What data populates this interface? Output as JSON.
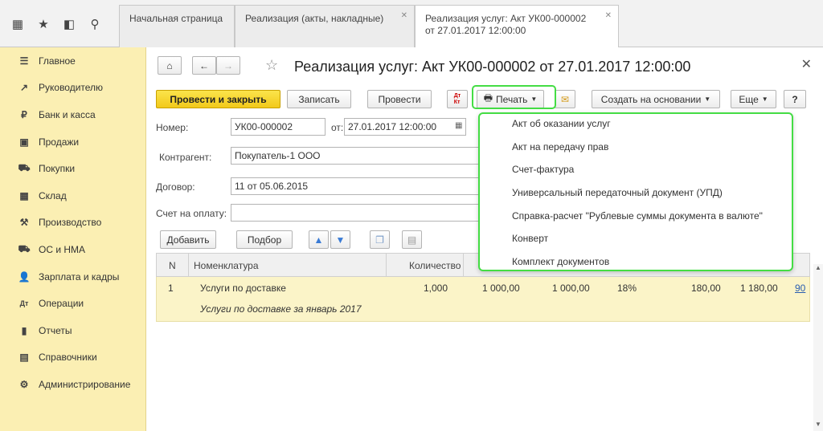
{
  "toolbar_icons": [
    "apps-grid-icon",
    "star-icon",
    "history-icon",
    "search-icon"
  ],
  "tabs": [
    {
      "label": "Начальная страница"
    },
    {
      "label": "Реализация (акты, накладные)"
    },
    {
      "label_line1": "Реализация услуг: Акт УК00-000002",
      "label_line2": "от 27.01.2017 12:00:00"
    }
  ],
  "sidebar": {
    "items": [
      {
        "label": "Главное",
        "icon": "☰"
      },
      {
        "label": "Руководителю",
        "icon": "↗"
      },
      {
        "label": "Банк и касса",
        "icon": "₽"
      },
      {
        "label": "Продажи",
        "icon": "▣"
      },
      {
        "label": "Покупки",
        "icon": "⛟"
      },
      {
        "label": "Склад",
        "icon": "▦"
      },
      {
        "label": "Производство",
        "icon": "⚒"
      },
      {
        "label": "ОС и НМА",
        "icon": "⛟"
      },
      {
        "label": "Зарплата и кадры",
        "icon": "👤"
      },
      {
        "label": "Операции",
        "icon": "Дт"
      },
      {
        "label": "Отчеты",
        "icon": "▮"
      },
      {
        "label": "Справочники",
        "icon": "▤"
      },
      {
        "label": "Администрирование",
        "icon": "⚙"
      }
    ]
  },
  "document": {
    "title": "Реализация услуг: Акт УК00-000002 от 27.01.2017 12:00:00",
    "buttons": {
      "post_close": "Провести и закрыть",
      "save": "Записать",
      "post": "Провести",
      "print": "Печать",
      "create_based": "Создать на основании",
      "more": "Еще",
      "help": "?"
    },
    "fields": {
      "number_label": "Номер:",
      "number_value": "УК00-000002",
      "date_label": "от:",
      "date_value": "27.01.2017 12:00:00",
      "counterparty_label": "Контрагент:",
      "counterparty_value": "Покупатель-1 ООО",
      "contract_label": "Договор:",
      "contract_value": "11 от 05.06.2015",
      "invoice_label": "Счет на оплату:",
      "invoice_value": ""
    },
    "table_buttons": {
      "add": "Добавить",
      "select": "Подбор"
    },
    "table": {
      "columns": [
        "N",
        "Номенклатура",
        "Количество"
      ],
      "rows": [
        {
          "n": "1",
          "name": "Услуги по доставке",
          "subname": "Услуги по доставке за январь 2017",
          "qty": "1,000",
          "price": "1 000,00",
          "sum": "1 000,00",
          "vat_rate": "18%",
          "vat": "180,00",
          "total": "1 180,00",
          "account": "90"
        }
      ]
    }
  },
  "print_menu": {
    "items": [
      "Акт об оказании услуг",
      "Акт на передачу прав",
      "Счет-фактура",
      "Универсальный передаточный документ (УПД)",
      "Справка-расчет \"Рублевые суммы документа в валюте\"",
      "Конверт",
      "Комплект документов"
    ]
  },
  "colors": {
    "accent": "#f2c91a",
    "highlight": "#44dd44",
    "sidebar": "#fbefb3"
  }
}
